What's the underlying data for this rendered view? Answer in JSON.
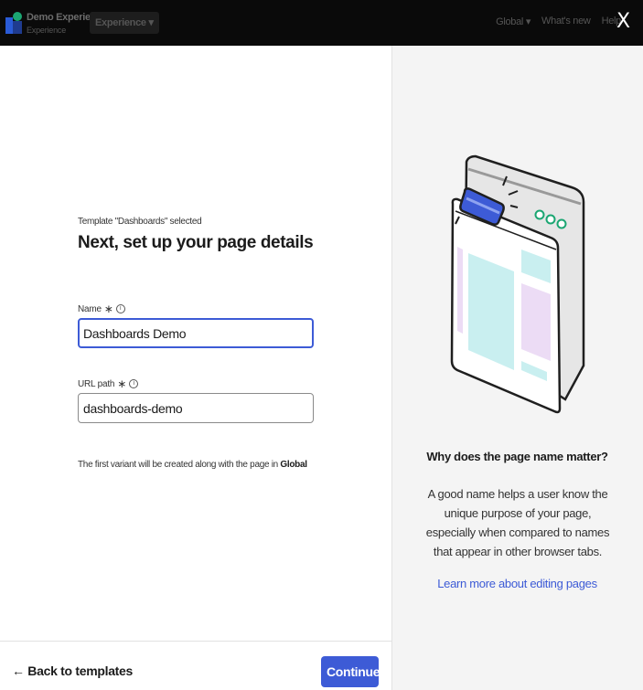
{
  "topbar": {
    "app_name": "Demo Experience",
    "app_subtitle": "Experience",
    "experience_switcher": "Experience ▾",
    "global_label": "Global ▾",
    "whats_new_label": "What's new",
    "help_label": "Help",
    "close_label": "X"
  },
  "form": {
    "template_label": "Template \"Dashboards\" selected",
    "title": "Next, set up your page details",
    "name_label": "Name",
    "name_value": "Dashboards Demo",
    "url_label": "URL path",
    "url_value": "dashboards-demo",
    "required_mark": "∗",
    "variant_note_prefix": "The first variant will be created along with the page in ",
    "variant_note_locale": "Global"
  },
  "footer": {
    "back_label": "← Back to templates",
    "continue_label": "Continue"
  },
  "info_panel": {
    "title": "Why does the page name matter?",
    "body": "A good name helps a user know the unique purpose of your page, especially when compared to names that appear in other browser tabs.",
    "link_label": "Learn more about editing pages"
  },
  "colors": {
    "primary": "#3d5bd6",
    "topbar_bg": "#0a0a0a",
    "panel_bg": "#f4f4f4",
    "illustration_teal": "#c9eff0",
    "illustration_lavender": "#ecdcf5",
    "illustration_green": "#1ba672"
  }
}
